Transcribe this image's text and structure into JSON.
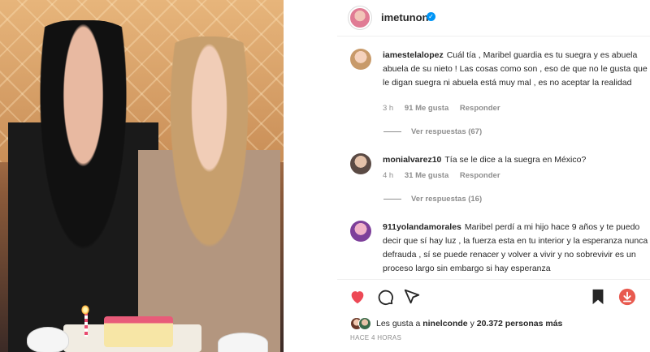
{
  "post": {
    "username": "imetunon",
    "verified_icon": "verified-badge-icon"
  },
  "comments": [
    {
      "username": "iamestelalopez",
      "text": "Cuál tía , Maribel guardia es tu suegra y es abuela abuela de su nieto ! Las cosas como son , eso de que no le gusta que le digan suegra ni abuela está muy mal , es no aceptar la realidad",
      "time": "3 h",
      "likes": "91 Me gusta",
      "reply": "Responder",
      "view_replies": "Ver respuestas (67)"
    },
    {
      "username": "monialvarez10",
      "text": "Tía se le dice a la suegra en México?",
      "time": "4 h",
      "likes": "31 Me gusta",
      "reply": "Responder",
      "view_replies": "Ver respuestas (16)"
    },
    {
      "username": "911yolandamorales",
      "text": "Maribel perdí a mi hijo hace 9 años y te puedo decir que sí hay luz , la fuerza esta en tu interior y la esperanza nunca defrauda , sí se puede renacer y volver a vivir y no sobrevivir es un proceso largo sin embargo si hay esperanza"
    }
  ],
  "actions": {
    "like_icon": "heart-icon",
    "comment_icon": "comment-icon",
    "share_icon": "share-icon",
    "save_icon": "bookmark-icon",
    "download_icon": "download-icon",
    "like_color": "#ed4956",
    "download_color": "#e85a4f"
  },
  "likes": {
    "prefix": "Les gusta a",
    "user": "ninelconde",
    "connector": "y",
    "count": "20.372 personas más"
  },
  "timestamp": "HACE 4 HORAS",
  "colors": {
    "verified": "#0095f6",
    "muted": "#8e8e8e",
    "text": "#262626"
  }
}
